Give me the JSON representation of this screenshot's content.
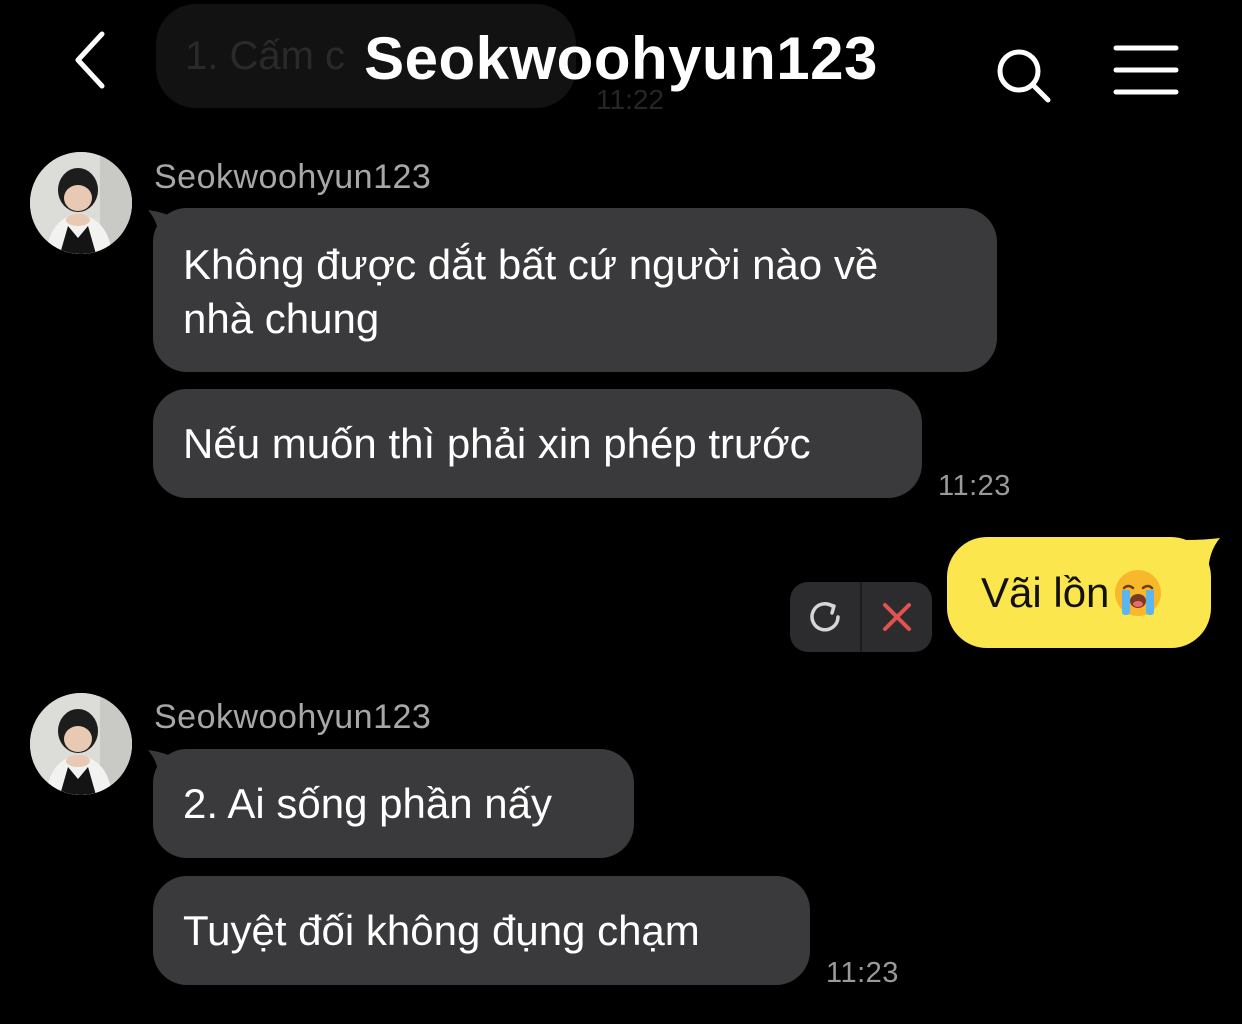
{
  "header": {
    "title": "Seokwoohyun123",
    "back_icon": "chevron-left-icon",
    "search_icon": "search-icon",
    "menu_icon": "hamburger-menu-icon"
  },
  "faded_message": {
    "text": "1. Cấm c",
    "time": "11:22"
  },
  "groups": [
    {
      "sender": "Seokwoohyun123",
      "messages": [
        "Không được dắt bất cứ người nào về",
        "nhà chung",
        "Nếu muốn thì phải xin phép trước"
      ],
      "time": "11:23"
    },
    {
      "sender": "Seokwoohyun123",
      "messages": [
        "2. Ai sống phần nấy",
        "Tuyệt đối không đụng chạm"
      ],
      "time": "11:23"
    }
  ],
  "my_message": {
    "text": "Vãi lồn",
    "emoji": "loudly-crying-face",
    "status": "failed",
    "retry_icon": "retry-icon",
    "delete_icon": "delete-x-icon"
  },
  "colors": {
    "background": "#000000",
    "bubble_other": "#3a3a3c",
    "bubble_mine": "#fbe64d",
    "delete_red": "#e0524f"
  }
}
